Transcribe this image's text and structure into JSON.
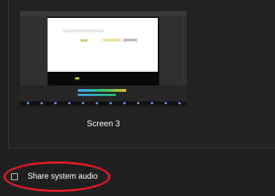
{
  "screens": [
    {
      "label": "Screen 3"
    }
  ],
  "share_audio": {
    "label": "Share system audio",
    "checked": false
  },
  "annotation": {
    "color": "#e81a25"
  },
  "icons": [
    "checkbox-icon"
  ]
}
